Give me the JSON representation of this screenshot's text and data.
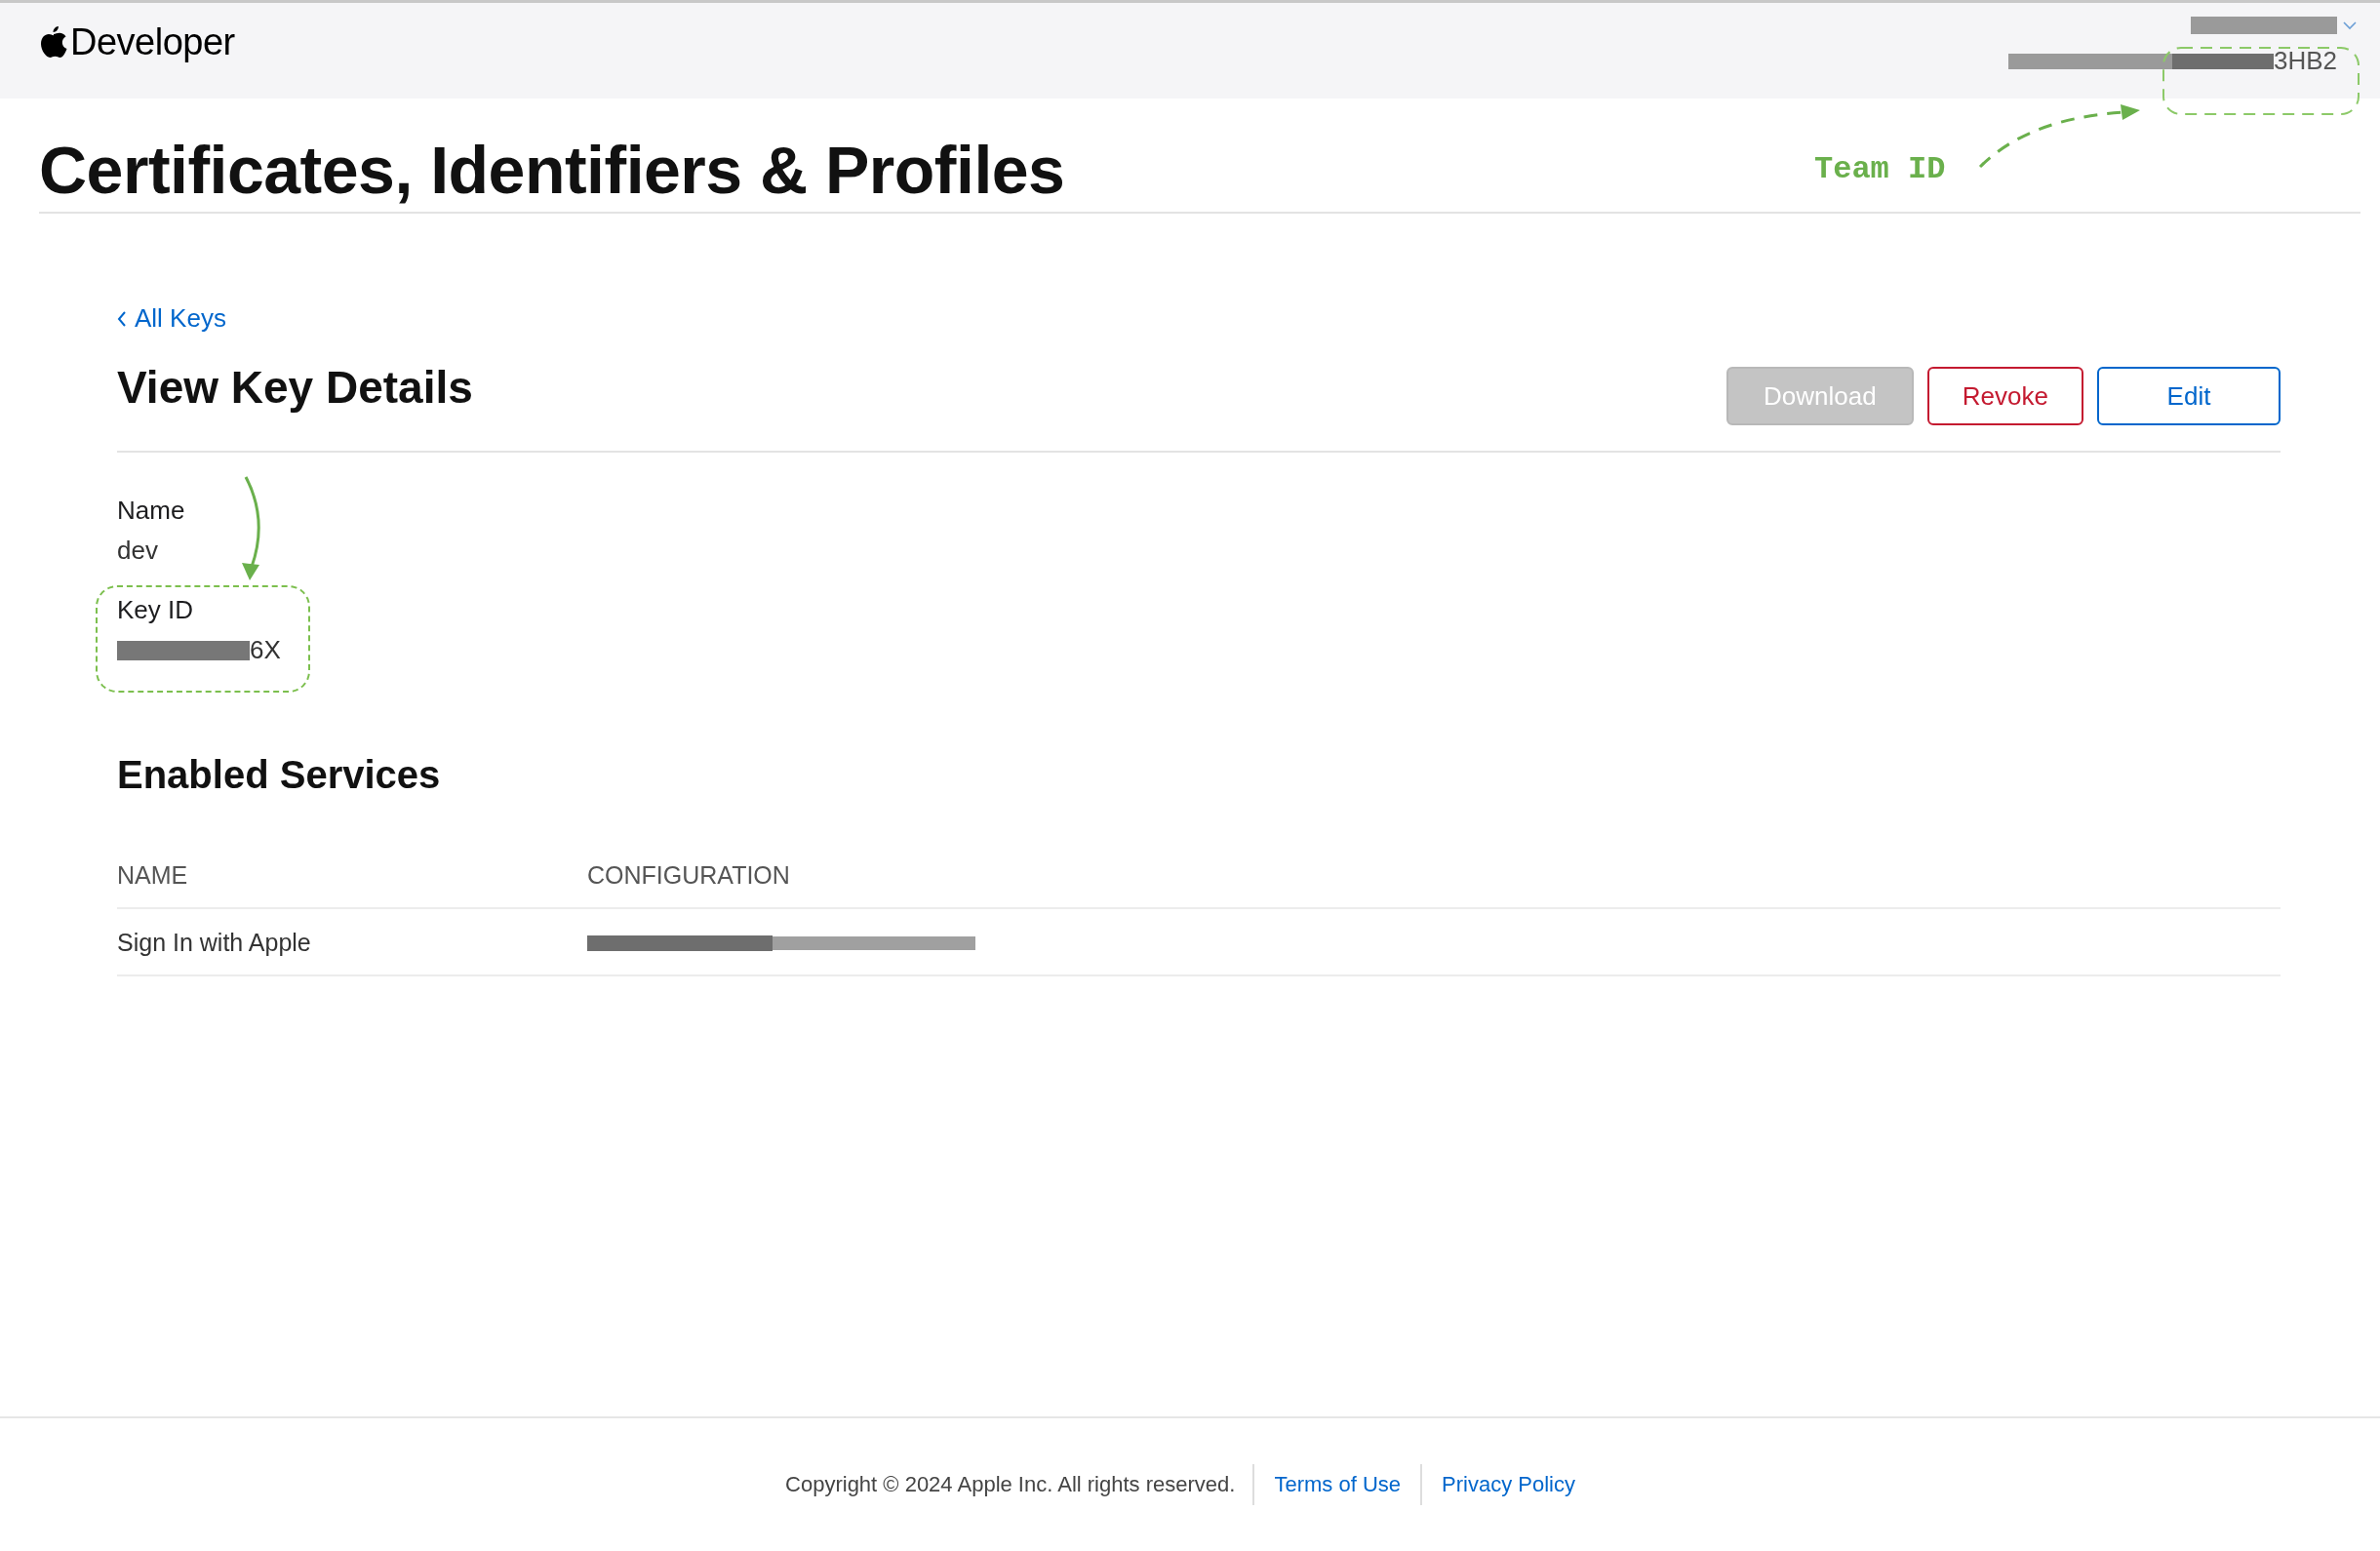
{
  "header": {
    "brand": "Developer",
    "team_id": "3HB2"
  },
  "page_title": "Certificates, Identifiers & Profiles",
  "annotation": {
    "label": "Team ID"
  },
  "back_link": "All Keys",
  "section_title": "View Key Details",
  "buttons": [
    {
      "label": "Download",
      "kind": "neutral",
      "disabled": true
    },
    {
      "label": "Revoke",
      "kind": "danger",
      "disabled": false
    },
    {
      "label": "Edit",
      "kind": "primary",
      "disabled": false
    }
  ],
  "details": [
    {
      "label": "Name",
      "value": "dev",
      "highlighted": false,
      "redacted": false
    },
    {
      "label": "Key ID",
      "value": "6X",
      "highlighted": true,
      "redacted": true
    }
  ],
  "services": {
    "title": "Enabled Services",
    "columns": [
      "NAME",
      "CONFIGURATION"
    ],
    "rows": [
      {
        "name": "Sign In with Apple"
      }
    ]
  },
  "footer": {
    "copyright": "Copyright © 2024 Apple Inc. All rights reserved.",
    "links": [
      "Terms of Use",
      "Privacy Policy"
    ]
  }
}
